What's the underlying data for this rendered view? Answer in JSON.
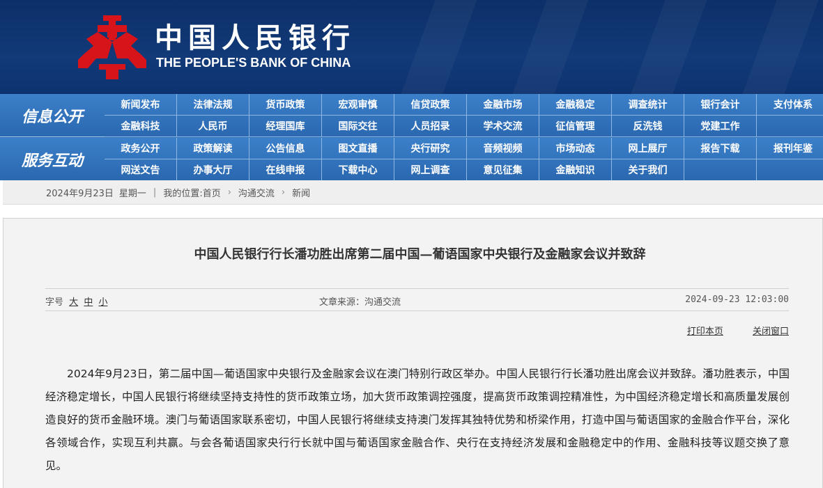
{
  "header": {
    "title_cn": "中国人民银行",
    "title_en": "THE PEOPLE'S BANK OF CHINA",
    "logo_color": "#d7141a",
    "bg_color": "#123a78"
  },
  "nav": {
    "info": {
      "label": "信息公开",
      "items": [
        "新闻发布",
        "法律法规",
        "货币政策",
        "宏观审慎",
        "信贷政策",
        "金融市场",
        "金融稳定",
        "调查统计",
        "银行会计",
        "支付体系",
        "金融科技",
        "人民币",
        "经理国库",
        "国际交往",
        "人员招录",
        "学术交流",
        "征信管理",
        "反洗钱",
        "党建工作",
        ""
      ]
    },
    "service": {
      "label": "服务互动",
      "items": [
        "政务公开",
        "政策解读",
        "公告信息",
        "图文直播",
        "央行研究",
        "音频视频",
        "市场动态",
        "网上展厅",
        "报告下载",
        "报刊年鉴",
        "网送文告",
        "办事大厅",
        "在线申报",
        "下载中心",
        "网上调查",
        "意见征集",
        "金融知识",
        "关于我们",
        "",
        ""
      ]
    }
  },
  "breadcrumb": {
    "date": "2024年9月23日",
    "weekday": "星期一",
    "location_label": "我的位置:首页",
    "level1": "沟通交流",
    "level2": "新闻"
  },
  "article": {
    "title": "中国人民银行行长潘功胜出席第二届中国—葡语国家中央银行及金融家会议并致辞",
    "font_size_label": "字号",
    "font_large": "大",
    "font_medium": "中",
    "font_small": "小",
    "source": "文章来源：沟通交流",
    "datetime": "2024-09-23 12:03:00",
    "print_label": "打印本页",
    "close_label": "关闭窗口",
    "body": "2024年9月23日，第二届中国—葡语国家中央银行及金融家会议在澳门特别行政区举办。中国人民银行行长潘功胜出席会议并致辞。潘功胜表示，中国经济稳定增长，中国人民银行将继续坚持支持性的货币政策立场，加大货币政策调控强度，提高货币政策调控精准性，为中国经济稳定增长和高质量发展创造良好的货币金融环境。澳门与葡语国家联系密切，中国人民银行将继续支持澳门发挥其独特优势和桥梁作用，打造中国与葡语国家的金融合作平台，深化各领域合作，实现互利共赢。与会各葡语国家央行行长就中国与葡语国家金融合作、央行在支持经济发展和金融稳定中的作用、金融科技等议题交换了意见。"
  }
}
